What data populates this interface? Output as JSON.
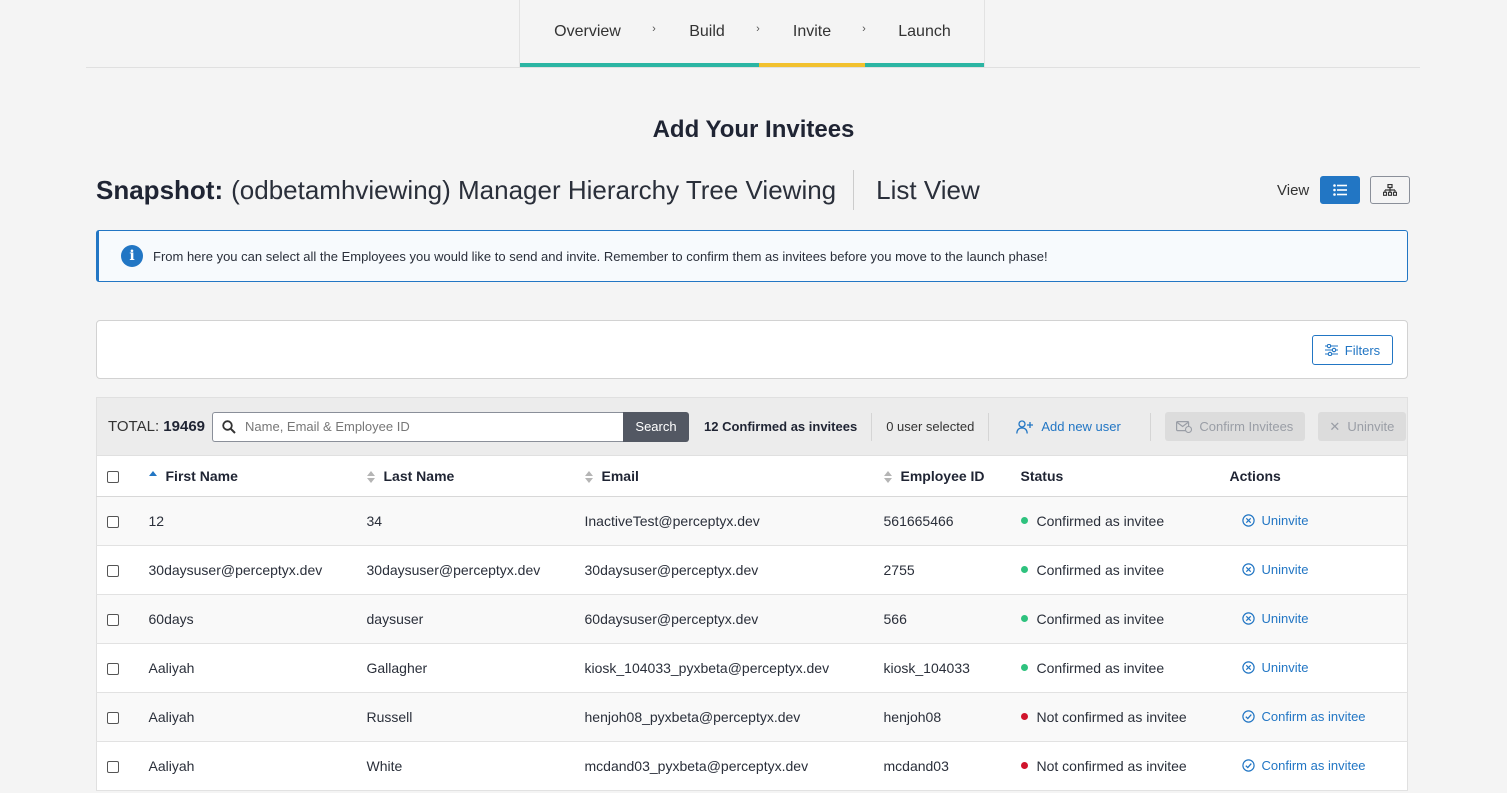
{
  "stepper": {
    "steps": [
      {
        "label": "Overview"
      },
      {
        "label": "Build"
      },
      {
        "label": "Invite"
      },
      {
        "label": "Launch"
      }
    ],
    "active_index": 2
  },
  "page": {
    "heading": "Add Your Invitees",
    "snapshot_label": "Snapshot:",
    "snapshot_name": "(odbetamhviewing) Manager Hierarchy Tree Viewing",
    "view_name": "List View",
    "view_label": "View"
  },
  "info": {
    "text": "From here you can select all the Employees you would like to send and invite. Remember to confirm them as invitees before you move to the launch phase!"
  },
  "filters": {
    "button_label": "Filters"
  },
  "toolbar": {
    "total_label": "TOTAL:",
    "total_value": "19469",
    "search_placeholder": "Name, Email & Employee ID",
    "search_button": "Search",
    "confirmed_count": "12 Confirmed as invitees",
    "selected_count": "0 user selected",
    "add_user": "Add new user",
    "confirm_invitees": "Confirm Invitees",
    "uninvite": "Uninvite"
  },
  "table": {
    "headers": {
      "first_name": "First Name",
      "last_name": "Last Name",
      "email": "Email",
      "employee_id": "Employee ID",
      "status": "Status",
      "actions": "Actions"
    },
    "rows": [
      {
        "first": "12",
        "last": "34",
        "email": "InactiveTest@perceptyx.dev",
        "id": "561665466",
        "status": "Confirmed as invitee",
        "action": "Uninvite"
      },
      {
        "first": "30daysuser@perceptyx.dev",
        "last": "30daysuser@perceptyx.dev",
        "email": "30daysuser@perceptyx.dev",
        "id": "2755",
        "status": "Confirmed as invitee",
        "action": "Uninvite"
      },
      {
        "first": "60days",
        "last": "daysuser",
        "email": "60daysuser@perceptyx.dev",
        "id": "566",
        "status": "Confirmed as invitee",
        "action": "Uninvite"
      },
      {
        "first": "Aaliyah",
        "last": "Gallagher",
        "email": "kiosk_104033_pyxbeta@perceptyx.dev",
        "id": "kiosk_104033",
        "status": "Confirmed as invitee",
        "action": "Uninvite"
      },
      {
        "first": "Aaliyah",
        "last": "Russell",
        "email": "henjoh08_pyxbeta@perceptyx.dev",
        "id": "henjoh08",
        "status": "Not confirmed as invitee",
        "action": "Confirm as invitee"
      },
      {
        "first": "Aaliyah",
        "last": "White",
        "email": "mcdand03_pyxbeta@perceptyx.dev",
        "id": "mcdand03",
        "status": "Not confirmed as invitee",
        "action": "Confirm as invitee"
      }
    ]
  },
  "colors": {
    "accent": "#2276c4",
    "step_done": "#2bb5a3",
    "step_active": "#f2c12e",
    "status_confirmed": "#2ec27e",
    "status_not_confirmed": "#d0142c"
  }
}
